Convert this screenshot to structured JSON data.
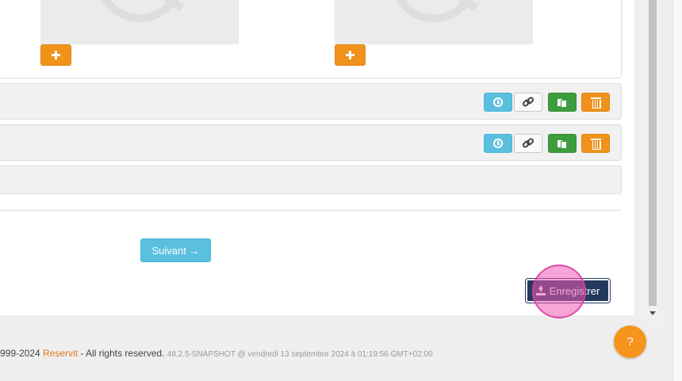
{
  "photos": {
    "add_label": "+"
  },
  "rows": [
    {
      "id": "row-1"
    },
    {
      "id": "row-2"
    },
    {
      "id": "row-3"
    }
  ],
  "navigation": {
    "next_label": "Suivant →"
  },
  "form": {
    "save_label": "Enregistrer"
  },
  "footer": {
    "copyright_prefix": "999-2024 ",
    "brand": "Reservit",
    "rights": " - All rights reserved. ",
    "version": "48.2.5-SNAPSHOT @ vendredi 13 septembre 2024 à 01:19:56 GMT+02:00"
  },
  "help": {
    "label": "?"
  },
  "colors": {
    "accent_orange": "#f0921c",
    "info_blue": "#5bc0de",
    "success_green": "#3d9d3d",
    "primary_navy": "#233a5e",
    "brand_orange": "#e0761c"
  },
  "icons": {
    "history": "clock-icon",
    "link": "link-icon",
    "copy": "copy-icon",
    "delete": "trash-icon",
    "add": "plus-icon",
    "save": "download-icon"
  }
}
